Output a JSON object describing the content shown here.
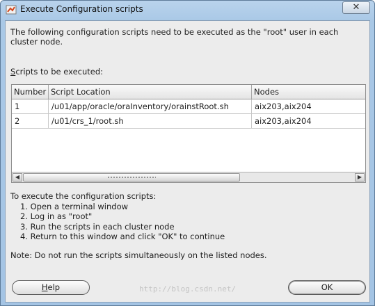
{
  "window": {
    "title": "Execute Configuration scripts",
    "close_glyph": "✕"
  },
  "intro_text": "The following configuration scripts need to be executed as the \"root\" user in each cluster node.",
  "scripts_label": {
    "mnemonic": "S",
    "rest": "cripts to be executed:"
  },
  "table": {
    "headers": [
      "Number",
      "Script Location",
      "Nodes"
    ],
    "rows": [
      [
        "1",
        "/u01/app/oracle/oraInventory/orainstRoot.sh",
        "aix203,aix204"
      ],
      [
        "2",
        "/u01/crs_1/root.sh",
        "aix203,aix204"
      ]
    ]
  },
  "instructions": {
    "heading": "To execute the configuration scripts:",
    "steps": [
      "1. Open a terminal window",
      "2. Log in as \"root\"",
      "3. Run the scripts in each cluster node",
      "4. Return to this window and click \"OK\" to continue"
    ]
  },
  "note": "Note: Do not run the scripts simultaneously on the listed nodes.",
  "buttons": {
    "help_mnemonic": "H",
    "help_rest": "elp",
    "ok": "OK"
  },
  "watermark": "http://blog.csdn.net/"
}
